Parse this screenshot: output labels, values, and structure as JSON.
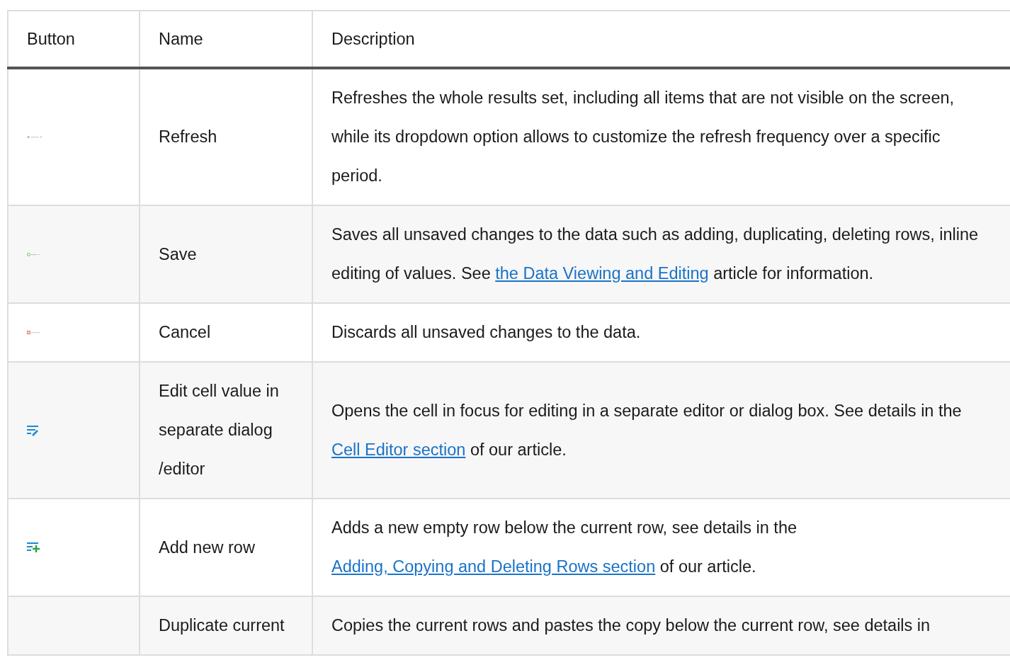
{
  "table": {
    "columns": [
      "Button",
      "Name",
      "Description"
    ],
    "rows": [
      {
        "kind": "refresh",
        "name": "Refresh",
        "description": [
          {
            "text": "Refreshes the whole results set, including all items that are not visible on the screen, while its dropdown option allows to customize the refresh frequency over a specific period.",
            "link": false
          }
        ]
      },
      {
        "kind": "save",
        "name": "Save",
        "description": [
          {
            "text": "Saves all unsaved changes to the data such as adding, duplicating, deleting rows, inline editing of values. See ",
            "link": false
          },
          {
            "text": "the Data Viewing and Editing",
            "link": true
          },
          {
            "text": " article for information.",
            "link": false
          }
        ]
      },
      {
        "kind": "cancel",
        "name": "Cancel",
        "description": [
          {
            "text": "Discards all unsaved changes to the data.",
            "link": false
          }
        ]
      },
      {
        "kind": "edit",
        "name": "Edit cell value in separate dialog /editor",
        "description": [
          {
            "text": "Opens the cell in focus for editing in a separate editor or dialog box. See details in the ",
            "link": false
          },
          {
            "text": "Cell Editor section",
            "link": true
          },
          {
            "text": " of our article.",
            "link": false
          }
        ]
      },
      {
        "kind": "add",
        "name": "Add new row",
        "description": [
          {
            "text": "Adds a new empty row below the current row, see details in the ",
            "link": false
          },
          {
            "text": "Adding, Copying and ",
            "link": true
          },
          {
            "text": "Deleting Rows section",
            "link": true
          },
          {
            "text": " of our article.",
            "link": false
          }
        ]
      },
      {
        "kind": "plain",
        "name": "Duplicate current",
        "description": [
          {
            "text": "Copies the current rows and pastes the copy below the current row, see details in",
            "link": false
          }
        ]
      }
    ]
  }
}
